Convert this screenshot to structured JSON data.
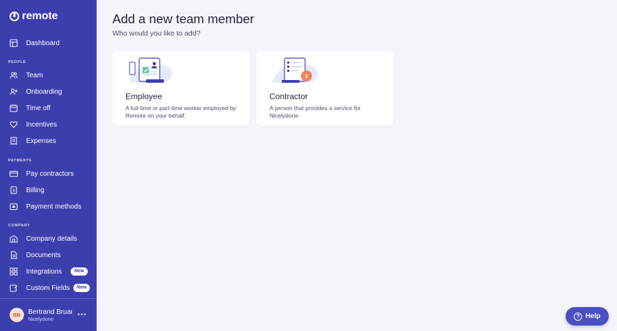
{
  "brand": {
    "name": "remote"
  },
  "sidebar": {
    "dashboard": "Dashboard",
    "sections": {
      "people": "PEOPLE",
      "payments": "PAYMENTS",
      "company": "COMPANY"
    },
    "people_items": [
      "Team",
      "Onboarding",
      "Time off",
      "Incentives",
      "Expenses"
    ],
    "payments_items": [
      "Pay contractors",
      "Billing",
      "Payment methods"
    ],
    "company_items": [
      "Company details",
      "Documents",
      "Integrations",
      "Custom Fields"
    ],
    "badge_new": "New"
  },
  "user": {
    "initials": "BB",
    "name": "Bertrand Bruandet",
    "org": "Nicelydone"
  },
  "main": {
    "title": "Add a new team member",
    "subtitle": "Who would you like to add?",
    "cards": [
      {
        "title": "Employee",
        "description": "A full-time or part-time worker employed by Remote on your behalf."
      },
      {
        "title": "Contractor",
        "description": "A person that provides a service for Nicelydone."
      }
    ]
  },
  "help": {
    "label": "Help"
  },
  "colors": {
    "sidebar": "#3b3fae",
    "background": "#f4f5f8",
    "help_button": "#4b4fc4",
    "accent_orange": "#f0845c"
  }
}
